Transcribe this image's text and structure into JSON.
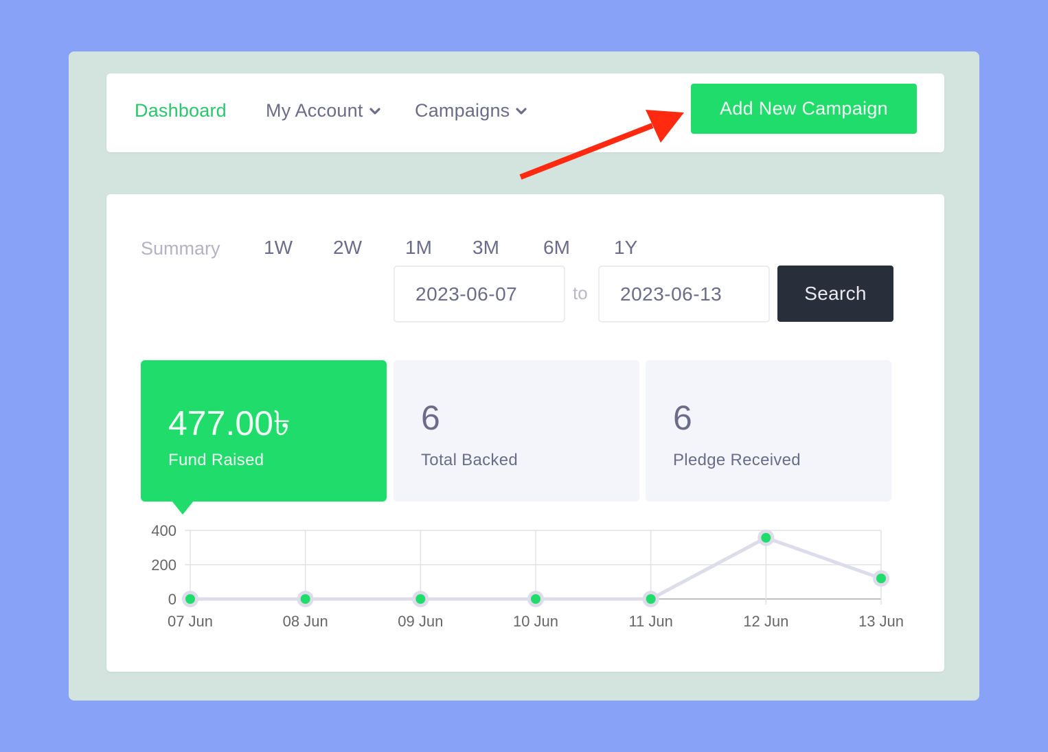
{
  "nav": {
    "items": [
      {
        "label": "Dashboard",
        "active": true,
        "dropdown": false
      },
      {
        "label": "My Account",
        "active": false,
        "dropdown": true
      },
      {
        "label": "Campaigns",
        "active": false,
        "dropdown": true
      }
    ],
    "add_button": "Add New Campaign"
  },
  "colors": {
    "accent": "#20dc6a",
    "nav_active": "#2ac66b",
    "text": "#6b6b8a",
    "dark_button": "#282f3b",
    "annotation_arrow": "#ff2a10",
    "background": "#87a2f7",
    "frame": "#d3e4df"
  },
  "summary": {
    "label": "Summary",
    "ranges": [
      "1W",
      "2W",
      "1M",
      "3M",
      "6M",
      "1Y"
    ],
    "from_date": "2023-06-07",
    "to_label": "to",
    "to_date": "2023-06-13",
    "search_button": "Search"
  },
  "stats": [
    {
      "value": "477.00৳",
      "label": "Fund Raised",
      "active": true
    },
    {
      "value": "6",
      "label": "Total Backed",
      "active": false
    },
    {
      "value": "6",
      "label": "Pledge Received",
      "active": false
    }
  ],
  "chart_data": {
    "type": "line",
    "title": "",
    "xlabel": "",
    "ylabel": "",
    "categories": [
      "07 Jun",
      "08 Jun",
      "09 Jun",
      "10 Jun",
      "11 Jun",
      "12 Jun",
      "13 Jun"
    ],
    "series": [
      {
        "name": "Fund Raised",
        "values": [
          0,
          0,
          0,
          0,
          0,
          357,
          120
        ]
      }
    ],
    "yticks": [
      0,
      200,
      400
    ],
    "ylim": [
      0,
      400
    ],
    "grid": true,
    "legend": "none"
  }
}
